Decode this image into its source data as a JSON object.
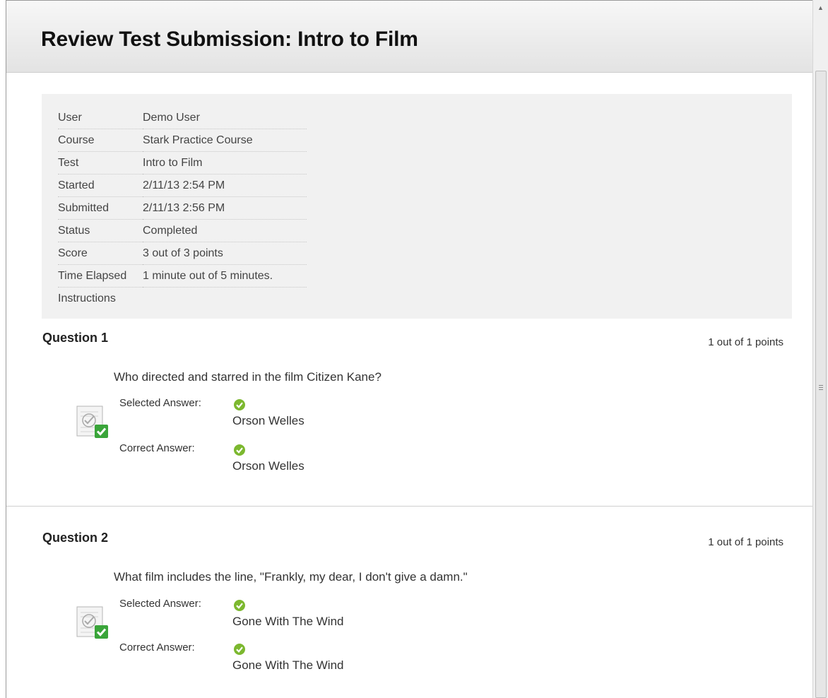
{
  "page": {
    "title": "Review Test Submission: Intro to Film"
  },
  "details": [
    {
      "label": "User",
      "value": "Demo User"
    },
    {
      "label": "Course",
      "value": "Stark Practice Course"
    },
    {
      "label": "Test",
      "value": "Intro to Film"
    },
    {
      "label": "Started",
      "value": "2/11/13 2:54 PM"
    },
    {
      "label": "Submitted",
      "value": "2/11/13 2:56 PM"
    },
    {
      "label": "Status",
      "value": "Completed"
    },
    {
      "label": "Score",
      "value": "3 out of 3 points"
    },
    {
      "label": "Time Elapsed",
      "value": "1 minute out of 5 minutes."
    },
    {
      "label": "Instructions",
      "value": ""
    }
  ],
  "questions": [
    {
      "title": "Question 1",
      "points": "1 out of 1 points",
      "text": "Who directed and starred in the film Citizen Kane?",
      "selected_label": "Selected Answer:",
      "selected_answer": "Orson Welles",
      "correct_label": "Correct Answer:",
      "correct_answer": "Orson Welles",
      "icon": "graded-correct-icon"
    },
    {
      "title": "Question 2",
      "points": "1 out of 1 points",
      "text": "What film includes the line, \"Frankly, my dear, I don't give a damn.\"",
      "selected_label": "Selected Answer:",
      "selected_answer": "Gone With The Wind",
      "correct_label": "Correct Answer:",
      "correct_answer": "Gone With The Wind",
      "icon": "graded-correct-icon"
    }
  ],
  "colors": {
    "check_green": "#7cb82f",
    "badge_green": "#3aa53a"
  }
}
